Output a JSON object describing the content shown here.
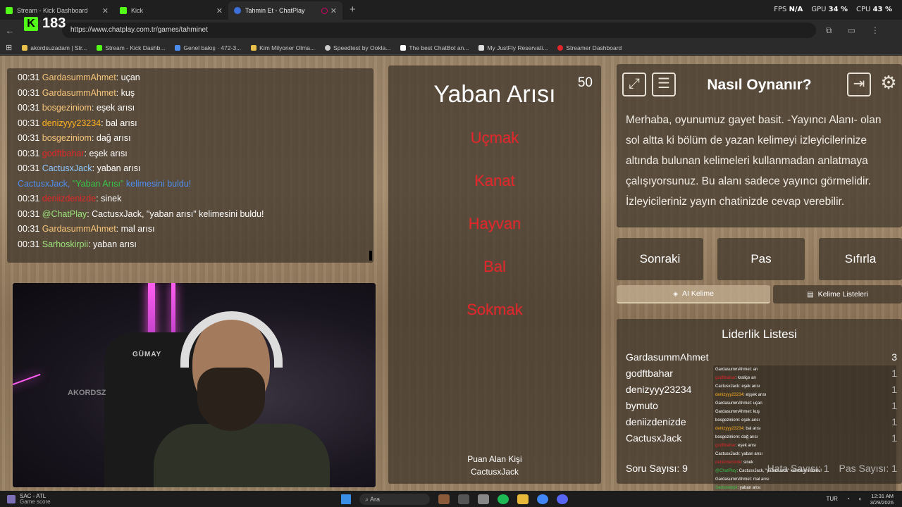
{
  "browser": {
    "tabs": [
      {
        "title": "Stream - Kick Dashboard",
        "active": false
      },
      {
        "title": "Kick",
        "active": false
      },
      {
        "title": "Tahmin Et - ChatPlay",
        "active": true
      }
    ],
    "url": "https://www.chatplay.com.tr/games/tahminet",
    "perf": {
      "fps_label": "FPS",
      "fps_value": "N/A",
      "gpu_label": "GPU",
      "gpu_value": "34 %",
      "cpu_label": "CPU",
      "cpu_value": "43 %"
    },
    "bookmarks": [
      "akordsuzadam | Str...",
      "Stream - Kick Dashb...",
      "Genel bakış · 472-3...",
      "Kim Milyoner Olma...",
      "Speedtest by Ookla...",
      "The best ChatBot an...",
      "My JustFly Reservati...",
      "Streamer Dashboard"
    ]
  },
  "kick_overlay": {
    "logo": "K",
    "viewer_count": "183"
  },
  "chat": [
    {
      "time": "00:31",
      "user": "GardasummAhmet",
      "color": "#f5c57a",
      "msg": ": uçan"
    },
    {
      "time": "00:31",
      "user": "GardasummAhmet",
      "color": "#f5c57a",
      "msg": ": kuş"
    },
    {
      "time": "00:31",
      "user": "bosgeziniom",
      "color": "#f5c57a",
      "msg": ": eşek arısı"
    },
    {
      "time": "00:31",
      "user": "denizyyy23234",
      "color": "#ffb020",
      "msg": ": bal arısı"
    },
    {
      "time": "00:31",
      "user": "bosgeziniom",
      "color": "#f5c57a",
      "msg": ": dağ arısı"
    },
    {
      "time": "00:31",
      "user": "godftbahar",
      "color": "#e0262a",
      "msg": ": eşek arısı"
    },
    {
      "time": "00:31",
      "user": "CactusxJack",
      "color": "#8ec8ff",
      "msg": ": yaban arısı"
    },
    {
      "system": true,
      "pre": "CactusxJack, ",
      "quote": "\"Yaban Arısı\"",
      "post": " kelimesini buldu!"
    },
    {
      "time": "00:31",
      "user": "deniizdenizde",
      "color": "#e0262a",
      "msg": ": sinek"
    },
    {
      "time": "00:31",
      "user": "@ChatPlay",
      "color": "#9be37a",
      "msg": ": CactusxJack, \"yaban arısı\" kelimesini buldu!"
    },
    {
      "time": "00:31",
      "user": "GardasummAhmet",
      "color": "#f5c57a",
      "msg": ": mal arısı"
    },
    {
      "time": "00:31",
      "user": "Sarhoskirpii",
      "color": "#9be37a",
      "msg": ": yaban arısı"
    }
  ],
  "webcam": {
    "chair_brand": "GÜMAY",
    "sign": "AKORDSZ"
  },
  "game": {
    "timer": "50",
    "word": "Yaban Arısı",
    "taboo": [
      "Uçmak",
      "Kanat",
      "Hayvan",
      "Bal",
      "Sokmak"
    ],
    "scorer_label": "Puan Alan Kişi",
    "scorer_name": "CactusxJack"
  },
  "info": {
    "title": "Nasıl Oynanır?",
    "text": "Merhaba, oyunumuz gayet basit. -Yayıncı Alanı- olan sol altta ki bölüm de yazan kelimeyi izleyicilerinize altında bulunan kelimeleri kullanmadan anlatmaya çalışıyorsunuz. Bu alanı sadece yayıncı görmelidir. İzleyicileriniz yayın chatinizde cevap verebilir."
  },
  "controls": {
    "next": "Sonraki",
    "pass": "Pas",
    "reset": "Sıfırla",
    "ai_tab": "AI Kelime",
    "lists_tab": "Kelime Listeleri"
  },
  "leaderboard": {
    "title": "Liderlik Listesi",
    "rows": [
      {
        "name": "GardasummAhmet",
        "score": "3"
      },
      {
        "name": "godftbahar",
        "score": "1"
      },
      {
        "name": "denizyyy23234",
        "score": "1"
      },
      {
        "name": "bymuto",
        "score": "1"
      },
      {
        "name": "deniizdenizde",
        "score": "1"
      },
      {
        "name": "CactusxJack",
        "score": "1"
      }
    ],
    "question_count": "Soru Sayısı: 9",
    "error_count": "Hata Sayısı: 1",
    "pass_count": "Pas Sayısı: 1"
  },
  "mini_chat": [
    {
      "user": "GardasummAhmet",
      "msg": ": arı",
      "c": ""
    },
    {
      "user": "godftbahar",
      "msg": ": kraliçe arı",
      "c": "r"
    },
    {
      "user": "CactusxJack",
      "msg": ": eşek arısı",
      "c": ""
    },
    {
      "user": "denizyyy23234",
      "msg": ": eşşek arısı",
      "c": "o"
    },
    {
      "user": "GardasummAhmet",
      "msg": ": uçan",
      "c": ""
    },
    {
      "user": "GardasummAhmet",
      "msg": ": kuş",
      "c": ""
    },
    {
      "user": "bosgeziniom",
      "msg": ": eşek arısı",
      "c": ""
    },
    {
      "user": "denizyyy23234",
      "msg": ": bal arısı",
      "c": "o"
    },
    {
      "user": "bosgeziniom",
      "msg": ": dağ arısı",
      "c": ""
    },
    {
      "user": "godftbahar",
      "msg": ": eşek arısı",
      "c": "r"
    },
    {
      "user": "CactusxJack",
      "msg": ": yaban arısı",
      "c": ""
    },
    {
      "user": "deniizdenizde",
      "msg": ": sinek",
      "c": "r"
    },
    {
      "user": "@ChatPlay",
      "msg": ": CactusxJack, \"yaban arısı\" kelimesini buldu!",
      "c": "g"
    },
    {
      "user": "GardasummAhmet",
      "msg": ": mal arısı",
      "c": ""
    },
    {
      "user": "Sarhoskirpii",
      "msg": ": yaban arısı",
      "c": "g"
    }
  ],
  "taskbar": {
    "weather_title": "SAC - ATL",
    "weather_sub": "Game score",
    "search": "Ara",
    "lang": "TUR",
    "time": "12:31 AM",
    "date": "3/29/2026"
  }
}
